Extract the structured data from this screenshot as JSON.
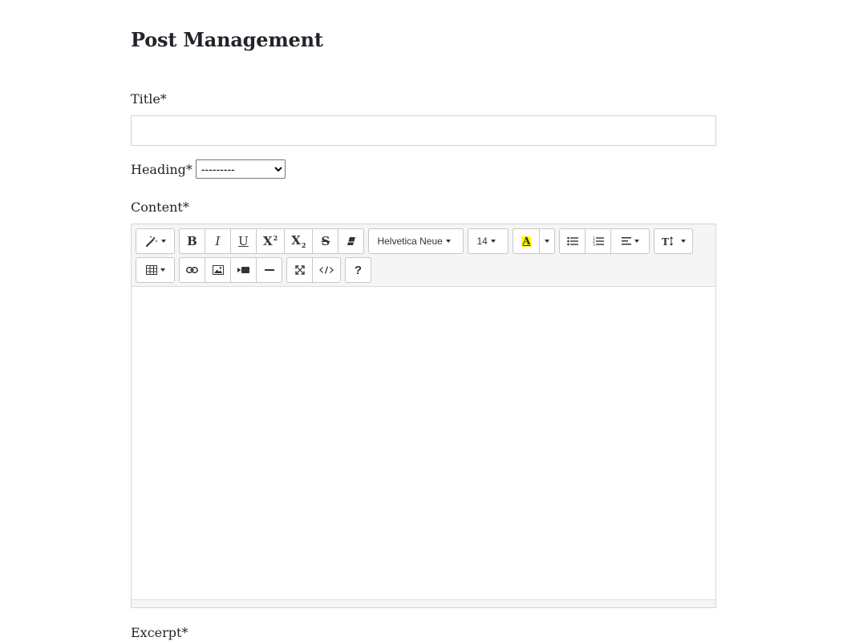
{
  "page": {
    "title": "Post Management"
  },
  "form": {
    "title_label": "Title*",
    "title_value": "",
    "heading_label": "Heading*",
    "heading_selected": "---------",
    "content_label": "Content*",
    "excerpt_label": "Excerpt*"
  },
  "toolbar": {
    "font_name": "Helvetica Neue",
    "font_size": "14",
    "highlight_letter": "A",
    "highlight_color": "#ffff00",
    "buttons_row1": [
      "style-icon",
      "bold-icon",
      "italic-icon",
      "underline-icon",
      "superscript-icon",
      "subscript-icon",
      "strikethrough-icon",
      "eraser-icon",
      "font-name-dropdown",
      "font-size-dropdown",
      "text-color-icon",
      "color-dropdown-caret",
      "unordered-list-icon",
      "ordered-list-icon",
      "paragraph-align-icon",
      "line-height-icon"
    ],
    "buttons_row2": [
      "table-icon",
      "link-icon",
      "picture-icon",
      "video-icon",
      "horizontal-rule-icon",
      "fullscreen-icon",
      "code-view-icon",
      "help-icon"
    ],
    "help_label": "?"
  },
  "colors": {
    "toolbar_bg": "#f5f5f5",
    "border": "#d6d6d6"
  }
}
